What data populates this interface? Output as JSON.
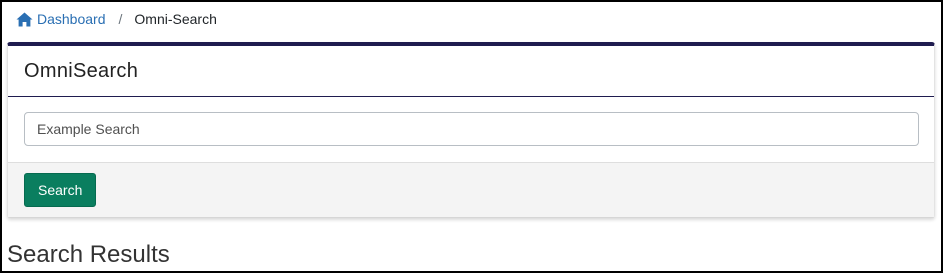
{
  "breadcrumb": {
    "home_label": "Dashboard",
    "separator": "/",
    "current": "Omni-Search"
  },
  "card": {
    "title": "OmniSearch",
    "search": {
      "placeholder": "Example Search",
      "value": ""
    },
    "button_label": "Search"
  },
  "results": {
    "title": "Search Results"
  },
  "colors": {
    "accent_border": "#1f1c4f",
    "link": "#2a6fb3",
    "button": "#0a7e5f"
  },
  "icons": {
    "home": "home-icon"
  }
}
